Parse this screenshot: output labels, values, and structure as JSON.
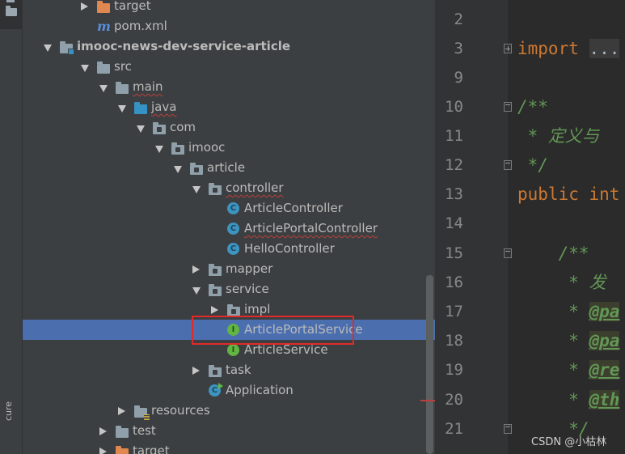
{
  "sidebar_tab": {
    "label": "cure"
  },
  "tree": {
    "rows": [
      {
        "label": "target",
        "icon": "folder-orange-icon"
      },
      {
        "label": "pom.xml",
        "icon": "maven-icon"
      },
      {
        "label": "imooc-news-dev-service-article",
        "icon": "module-folder-icon"
      },
      {
        "label": "src",
        "icon": "folder-icon"
      },
      {
        "label": "main",
        "icon": "folder-icon"
      },
      {
        "label": "java",
        "icon": "source-folder-icon"
      },
      {
        "label": "com",
        "icon": "package-icon"
      },
      {
        "label": "imooc",
        "icon": "package-icon"
      },
      {
        "label": "article",
        "icon": "package-icon"
      },
      {
        "label": "controller",
        "icon": "package-icon"
      },
      {
        "label": "ArticleController",
        "icon": "class-icon"
      },
      {
        "label": "ArticlePortalController",
        "icon": "class-icon"
      },
      {
        "label": "HelloController",
        "icon": "class-icon"
      },
      {
        "label": "mapper",
        "icon": "package-icon"
      },
      {
        "label": "service",
        "icon": "package-icon"
      },
      {
        "label": "impl",
        "icon": "package-icon"
      },
      {
        "label": "ArticlePortalService",
        "icon": "interface-icon"
      },
      {
        "label": "ArticleService",
        "icon": "interface-icon"
      },
      {
        "label": "task",
        "icon": "package-icon"
      },
      {
        "label": "Application",
        "icon": "spring-boot-class-icon"
      },
      {
        "label": "resources",
        "icon": "resources-folder-icon"
      },
      {
        "label": "test",
        "icon": "folder-icon"
      },
      {
        "label": "target",
        "icon": "folder-orange-icon"
      }
    ],
    "icon_letters": {
      "class": "C",
      "interface": "I",
      "app": "C"
    },
    "maven_glyph": "m",
    "selected_label": "ArticlePortalService"
  },
  "editor": {
    "lines": [
      {
        "num": "2",
        "parts": []
      },
      {
        "num": "3",
        "parts": [
          {
            "cls": "kw",
            "text": "import "
          },
          {
            "cls": "folded",
            "text": "..."
          }
        ]
      },
      {
        "num": "9",
        "parts": []
      },
      {
        "num": "10",
        "parts": [
          {
            "cls": "cmt",
            "text": "/**"
          }
        ]
      },
      {
        "num": "11",
        "parts": [
          {
            "cls": "cmt",
            "text": " * 定义与"
          }
        ]
      },
      {
        "num": "12",
        "parts": [
          {
            "cls": "cmt",
            "text": " */"
          }
        ]
      },
      {
        "num": "13",
        "parts": [
          {
            "cls": "kw",
            "text": "public int"
          }
        ]
      },
      {
        "num": "14",
        "parts": []
      },
      {
        "num": "15",
        "parts": [
          {
            "cls": "cmt",
            "text": "    /**"
          }
        ]
      },
      {
        "num": "16",
        "parts": [
          {
            "cls": "cmt",
            "text": "     * 发"
          }
        ]
      },
      {
        "num": "17",
        "parts": [
          {
            "cls": "cmt",
            "text": "     * "
          },
          {
            "cls": "tag",
            "text": "@pa"
          }
        ]
      },
      {
        "num": "18",
        "parts": [
          {
            "cls": "cmt",
            "text": "     * "
          },
          {
            "cls": "tag",
            "text": "@pa"
          }
        ]
      },
      {
        "num": "19",
        "parts": [
          {
            "cls": "cmt",
            "text": "     * "
          },
          {
            "cls": "tag",
            "text": "@re"
          }
        ]
      },
      {
        "num": "20",
        "parts": [
          {
            "cls": "cmt",
            "text": "     * "
          },
          {
            "cls": "tag",
            "text": "@th"
          }
        ]
      },
      {
        "num": "21",
        "parts": [
          {
            "cls": "cmt",
            "text": "     */"
          }
        ]
      }
    ]
  },
  "watermark": "CSDN @小枯林",
  "colors": {
    "selection": "#4b6eaf",
    "highlight_box": "#e02a2a",
    "keyword": "#cc7832",
    "comment": "#629755"
  }
}
